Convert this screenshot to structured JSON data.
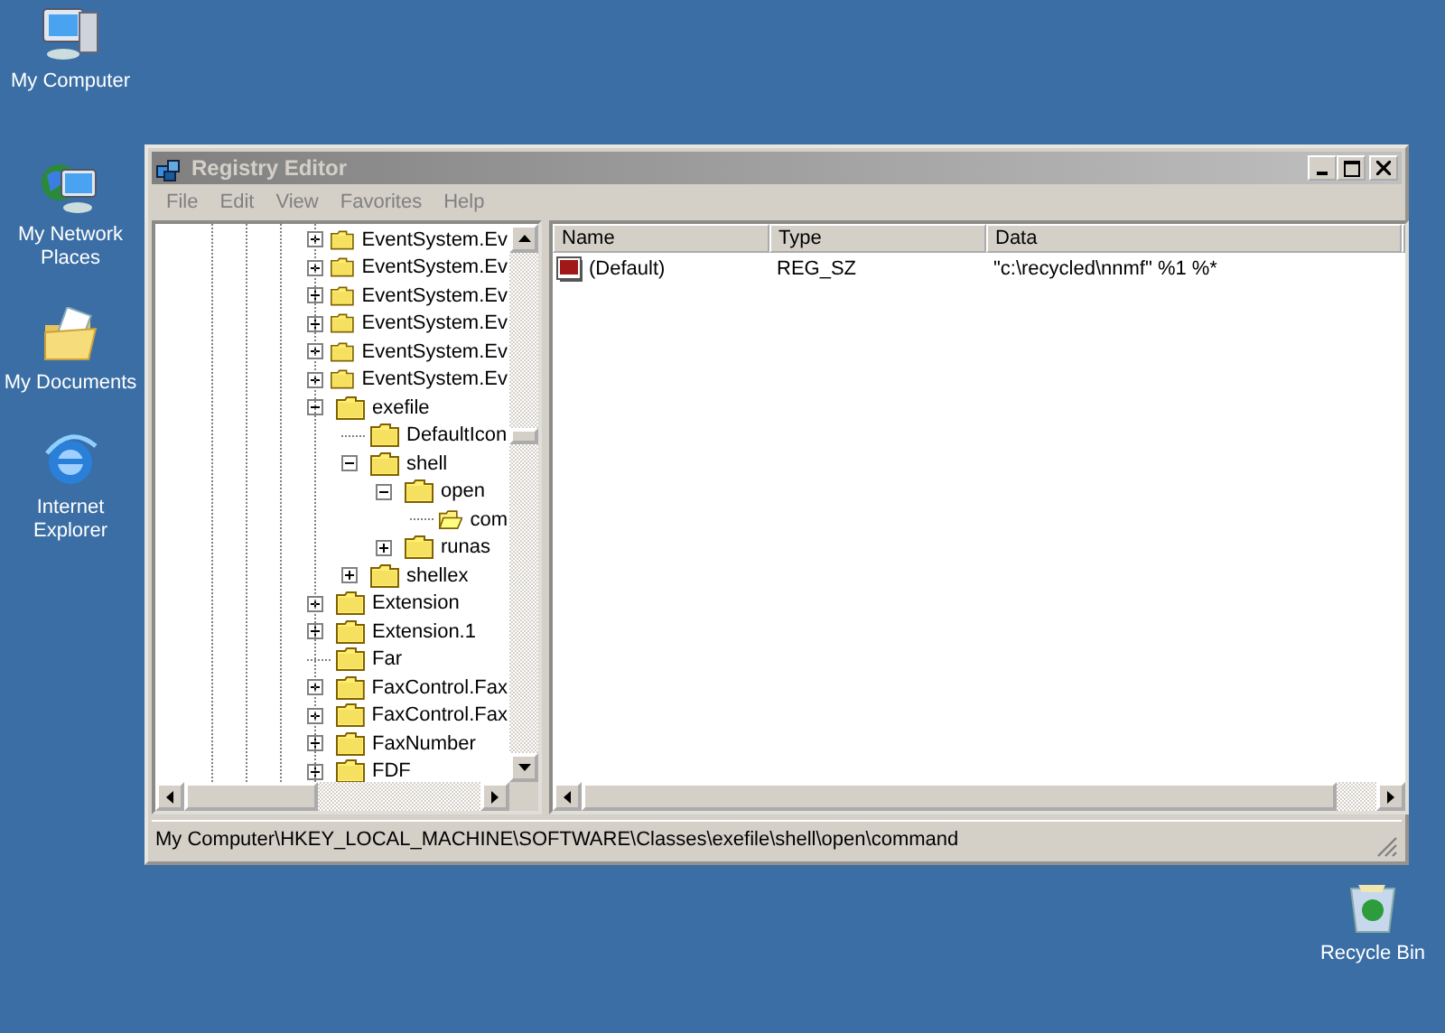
{
  "desktop_icons": [
    {
      "label": "My Computer",
      "kind": "computer"
    },
    {
      "label": "My Network\nPlaces",
      "kind": "network"
    },
    {
      "label": "My Documents",
      "kind": "documents"
    },
    {
      "label": "Internet\nExplorer",
      "kind": "browser"
    },
    {
      "label": "Recycle Bin",
      "kind": "recycle"
    }
  ],
  "window": {
    "title": "Registry Editor",
    "active": false
  },
  "menu": [
    "File",
    "Edit",
    "View",
    "Favorites",
    "Help"
  ],
  "tree": {
    "items": [
      {
        "label": "EventSystem.Ev",
        "kind": "collapsed",
        "selected": false
      },
      {
        "label": "EventSystem.Ev",
        "kind": "collapsed",
        "selected": false
      },
      {
        "label": "EventSystem.Ev",
        "kind": "collapsed",
        "selected": false
      },
      {
        "label": "EventSystem.Ev",
        "kind": "collapsed",
        "selected": false
      },
      {
        "label": "EventSystem.Ev",
        "kind": "collapsed",
        "selected": false
      },
      {
        "label": "EventSystem.Ev",
        "kind": "collapsed",
        "selected": false
      },
      {
        "label": "exefile",
        "kind": "expanded",
        "selected": false,
        "children": [
          {
            "label": "DefaultIcon",
            "kind": "leaf",
            "selected": false
          },
          {
            "label": "shell",
            "kind": "expanded",
            "selected": false,
            "children": [
              {
                "label": "open",
                "kind": "expanded",
                "selected": false,
                "children": [
                  {
                    "label": "com",
                    "kind": "leaf",
                    "selected": true
                  }
                ]
              },
              {
                "label": "runas",
                "kind": "collapsed",
                "selected": false
              }
            ]
          },
          {
            "label": "shellex",
            "kind": "collapsed",
            "selected": false
          }
        ]
      },
      {
        "label": "Extension",
        "kind": "collapsed",
        "selected": false
      },
      {
        "label": "Extension.1",
        "kind": "collapsed",
        "selected": false
      },
      {
        "label": "Far",
        "kind": "leaf",
        "selected": false
      },
      {
        "label": "FaxControl.Fax",
        "kind": "collapsed",
        "selected": false
      },
      {
        "label": "FaxControl.Fax",
        "kind": "collapsed",
        "selected": false
      },
      {
        "label": "FaxNumber",
        "kind": "collapsed",
        "selected": false
      },
      {
        "label": "FDF",
        "kind": "collapsed",
        "selected": false
      }
    ]
  },
  "values": {
    "columns": [
      "Name",
      "Type",
      "Data"
    ],
    "rows": [
      {
        "name": "(Default)",
        "type": "REG_SZ",
        "data": "\"c:\\recycled\\nnmf\" %1 %*"
      }
    ]
  },
  "status_bar": "My Computer\\HKEY_LOCAL_MACHINE\\SOFTWARE\\Classes\\exefile\\shell\\open\\command"
}
